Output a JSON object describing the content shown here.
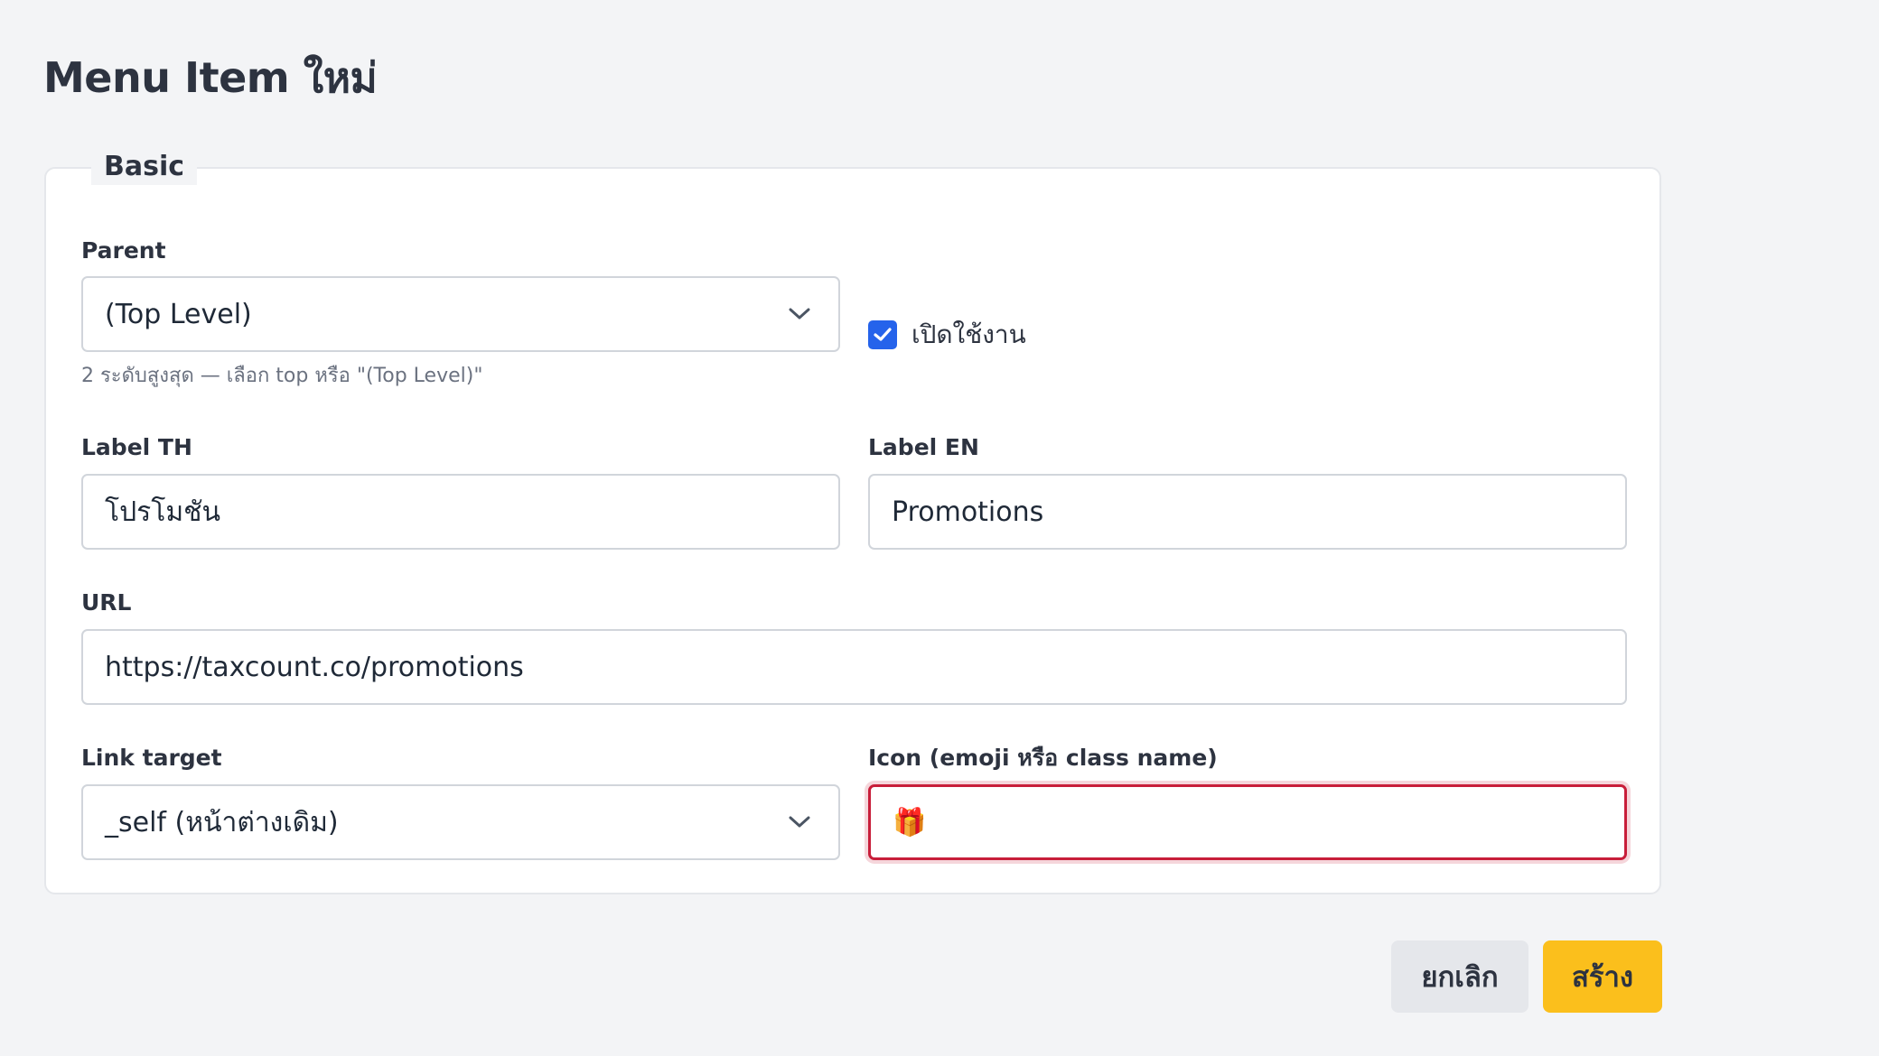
{
  "page": {
    "title": "Menu Item ใหม่"
  },
  "basic_section": {
    "legend": "Basic",
    "parent": {
      "label": "Parent",
      "value": "(Top Level)",
      "hint": "2 ระดับสูงสุด — เลือก top หรือ \"(Top Level)\""
    },
    "enabled": {
      "label": "เปิดใช้งาน",
      "checked": true
    },
    "label_th": {
      "label": "Label TH",
      "value": "โปรโมชัน"
    },
    "label_en": {
      "label": "Label EN",
      "value": "Promotions"
    },
    "url": {
      "label": "URL",
      "value": "https://taxcount.co/promotions"
    },
    "link_target": {
      "label": "Link target",
      "value": "_self (หน้าต่างเดิม)"
    },
    "icon": {
      "label": "Icon (emoji หรือ class name)",
      "value": "🎁",
      "state": "error"
    }
  },
  "actions": {
    "cancel_label": "ยกเลิก",
    "create_label": "สร้าง"
  },
  "colors": {
    "primary_button": "#fbbf1c",
    "checkbox": "#2563eb",
    "error_border": "#c81e3a",
    "background": "#f3f4f6"
  }
}
